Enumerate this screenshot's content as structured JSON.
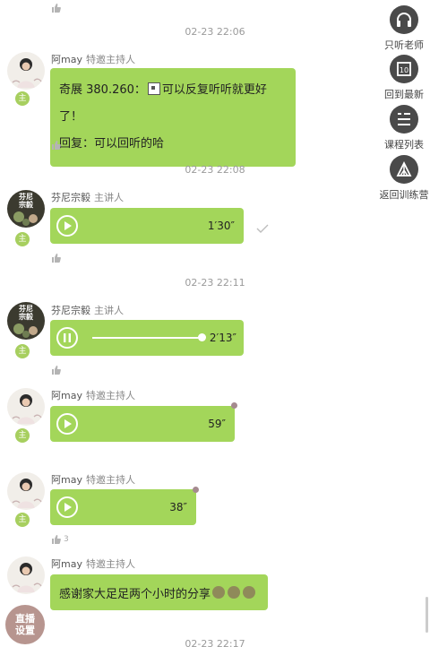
{
  "top_like": {
    "icon": "thumbs-up-icon"
  },
  "timestamps": [
    "02-23 22:06",
    "02-23 22:08",
    "02-23 22:11",
    "02-23 22:17"
  ],
  "sidebar": [
    {
      "label": "只听老师",
      "icon": "headphones-icon"
    },
    {
      "label": "回到最新",
      "icon": "latest-icon"
    },
    {
      "label": "课程列表",
      "icon": "list-icon"
    },
    {
      "label": "返回训练营",
      "icon": "tent-icon"
    }
  ],
  "messages": [
    {
      "author": "阿may",
      "role": "特邀主持人",
      "line1_prefix": "奇展 380.260：",
      "line1_suffix": "可以反复听听就更好了！",
      "line2": "回复：可以回听的哈",
      "likes": ""
    },
    {
      "author": "芬尼宗毅",
      "role": "主讲人",
      "duration": "1′30″",
      "state": "paused",
      "likes": ""
    },
    {
      "author": "芬尼宗毅",
      "role": "主讲人",
      "duration": "2′13″",
      "state": "playing",
      "progress": 1.0,
      "likes": ""
    },
    {
      "author": "阿may",
      "role": "特邀主持人",
      "duration": "59″",
      "unread": true,
      "likes": ""
    },
    {
      "author": "阿may",
      "role": "特邀主持人",
      "duration": "38″",
      "unread": true,
      "likes": "3"
    },
    {
      "author": "阿may",
      "role": "特邀主持人",
      "text": "感谢家大足足两个小时的分享",
      "emoji": [
        "clap-emoji",
        "clap-emoji",
        "clap-emoji"
      ]
    }
  ],
  "avatar_badge": "主",
  "speaker_avatar_text": [
    "芬尼",
    "宗毅"
  ],
  "float_button": {
    "line1": "直播",
    "line2": "设置"
  },
  "colors": {
    "bubble": "#a3d65a",
    "sidebar_icon_bg": "#4a4a4a",
    "float": "#b7958f"
  }
}
